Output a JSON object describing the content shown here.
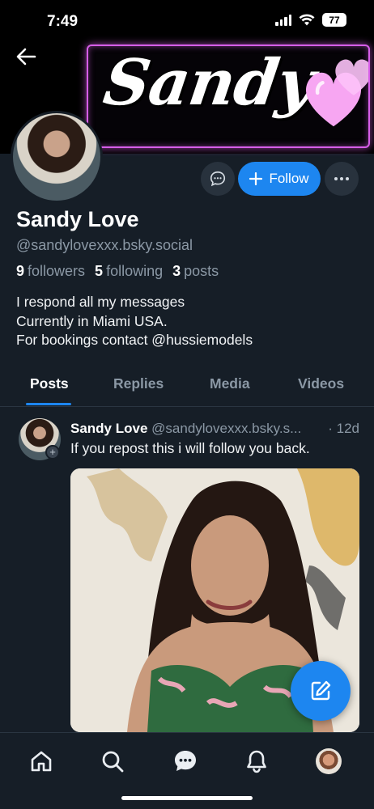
{
  "status_bar": {
    "time": "7:49",
    "battery": "77"
  },
  "banner": {
    "name_text": "Sandy"
  },
  "profile": {
    "display_name": "Sandy Love",
    "handle": "@sandylovexxx.bsky.social",
    "followers_count": "9",
    "followers_label": "followers",
    "following_count": "5",
    "following_label": "following",
    "posts_count": "3",
    "posts_label": "posts",
    "bio_lines": [
      "I respond all my messages",
      "Currently in Miami USA.",
      "For bookings contact @hussiemodels"
    ]
  },
  "actions": {
    "follow_label": "Follow"
  },
  "tabs": [
    {
      "label": "Posts",
      "active": true
    },
    {
      "label": "Replies",
      "active": false
    },
    {
      "label": "Media",
      "active": false
    },
    {
      "label": "Videos",
      "active": false
    }
  ],
  "post": {
    "author": "Sandy Love",
    "handle": "@sandylovexxx.bsky.s...",
    "time": "· 12d",
    "text": "If you repost this i will follow you back."
  },
  "colors": {
    "accent": "#1d86f0",
    "background": "#161e27",
    "muted": "#8b98a5",
    "banner_glow": "#d65ee8"
  },
  "icons": [
    "back-arrow-icon",
    "chat-icon",
    "plus-icon",
    "more-icon",
    "compose-icon",
    "home-icon",
    "search-icon",
    "messages-icon",
    "bell-icon"
  ]
}
